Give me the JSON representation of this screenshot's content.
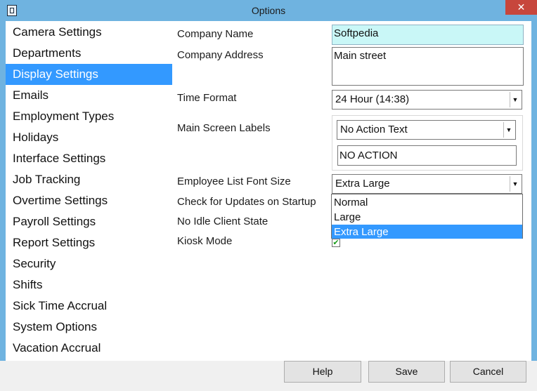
{
  "window": {
    "title": "Options",
    "close_glyph": "✕"
  },
  "sidebar": {
    "items": [
      {
        "label": "Camera Settings",
        "selected": false
      },
      {
        "label": "Departments",
        "selected": false
      },
      {
        "label": "Display Settings",
        "selected": true
      },
      {
        "label": "Emails",
        "selected": false
      },
      {
        "label": "Employment Types",
        "selected": false
      },
      {
        "label": "Holidays",
        "selected": false
      },
      {
        "label": "Interface Settings",
        "selected": false
      },
      {
        "label": "Job Tracking",
        "selected": false
      },
      {
        "label": "Overtime Settings",
        "selected": false
      },
      {
        "label": "Payroll Settings",
        "selected": false
      },
      {
        "label": "Report Settings",
        "selected": false
      },
      {
        "label": "Security",
        "selected": false
      },
      {
        "label": "Shifts",
        "selected": false
      },
      {
        "label": "Sick Time Accrual",
        "selected": false
      },
      {
        "label": "System Options",
        "selected": false
      },
      {
        "label": "Vacation Accrual",
        "selected": false
      }
    ]
  },
  "form": {
    "company_name_label": "Company Name",
    "company_name_value": "Softpedia",
    "company_address_label": "Company Address",
    "company_address_value": "Main street",
    "time_format_label": "Time Format",
    "time_format_value": "24 Hour (14:38)",
    "main_screen_labels_label": "Main Screen Labels",
    "main_screen_labels_select": "No Action Text",
    "main_screen_labels_value": "NO ACTION",
    "font_size_label": "Employee List Font Size",
    "font_size_value": "Extra Large",
    "font_size_options": [
      "Normal",
      "Large",
      "Extra Large"
    ],
    "font_size_selected": "Extra Large",
    "check_updates_label": "Check for Updates on Startup",
    "no_idle_label": "No Idle Client State",
    "kiosk_label": "Kiosk Mode",
    "kiosk_checked": true
  },
  "buttons": {
    "help": "Help",
    "save": "Save",
    "cancel": "Cancel"
  },
  "icons": {
    "combo_arrow": "▼",
    "checkmark": "✔"
  },
  "colors": {
    "accent": "#3399ff",
    "frame": "#6fb3e0",
    "company_name_bg": "#c9f7f7",
    "close": "#c7463c"
  }
}
